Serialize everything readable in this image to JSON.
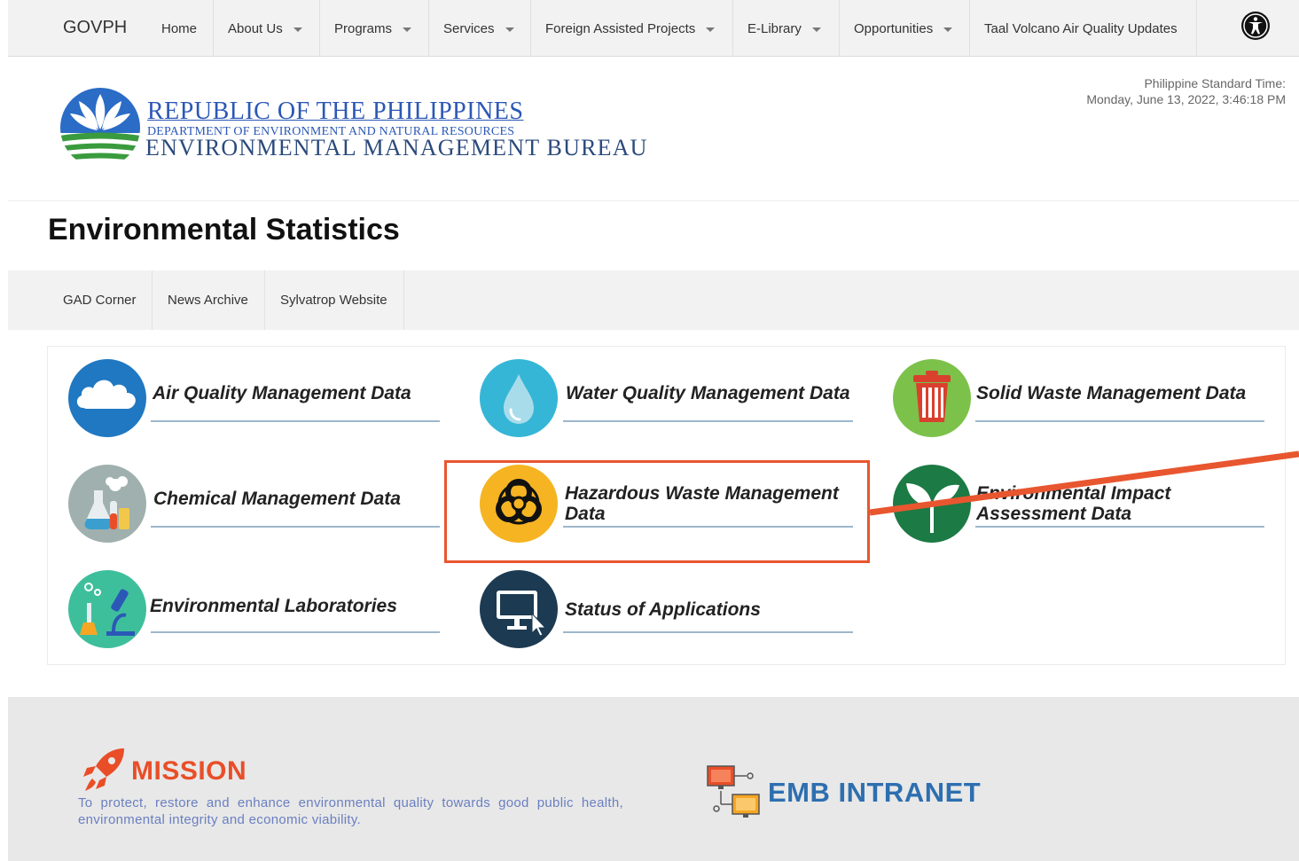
{
  "topnav": {
    "brand": "GOVPH",
    "items": [
      {
        "label": "Home",
        "dropdown": false
      },
      {
        "label": "About Us",
        "dropdown": true
      },
      {
        "label": "Programs",
        "dropdown": true
      },
      {
        "label": "Services",
        "dropdown": true
      },
      {
        "label": "Foreign Assisted Projects",
        "dropdown": true
      },
      {
        "label": "E-Library",
        "dropdown": true
      },
      {
        "label": "Opportunities",
        "dropdown": true
      },
      {
        "label": "Taal Volcano Air Quality Updates",
        "dropdown": false
      }
    ],
    "accessibility_icon": "accessibility-icon"
  },
  "header": {
    "line1": "REPUBLIC OF THE PHILIPPINES",
    "line2": "DEPARTMENT OF ENVIRONMENT AND NATURAL RESOURCES",
    "line3": "ENVIRONMENTAL MANAGEMENT BUREAU",
    "time_label": "Philippine Standard Time:",
    "time_value": "Monday, June 13, 2022, 3:46:18 PM"
  },
  "page_title": "Environmental Statistics",
  "subnav": {
    "items": [
      "GAD Corner",
      "News Archive",
      "Sylvatrop Website"
    ]
  },
  "tiles": [
    {
      "label": "Air Quality Management Data",
      "icon": "cloud-icon",
      "color": "#1f78c1"
    },
    {
      "label": "Water Quality Management Data",
      "icon": "water-drop-icon",
      "color": "#35b6d6"
    },
    {
      "label": "Solid Waste Management Data",
      "icon": "trash-bin-icon",
      "color": "#7cc24a"
    },
    {
      "label": "Chemical Management Data",
      "icon": "chemistry-flask-icon",
      "color": "#8fa5a5"
    },
    {
      "label": "Hazardous Waste Management Data",
      "icon": "biohazard-icon",
      "color": "#f6b422"
    },
    {
      "label": "Environmental Impact Assessment Data",
      "icon": "leaf-sprout-icon",
      "color": "#1c7a44"
    },
    {
      "label": "Environmental Laboratories",
      "icon": "microscope-icon",
      "color": "#3ebf9c"
    },
    {
      "label": "Status of Applications",
      "icon": "computer-monitor-icon",
      "color": "#1c3a52"
    }
  ],
  "highlight_color": "#e8562f",
  "footer": {
    "mission_title": "MISSION",
    "mission_text": "To protect, restore and enhance environmental quality towards good public health, environmental integrity and economic viability.",
    "intranet_label": "EMB INTRANET"
  }
}
